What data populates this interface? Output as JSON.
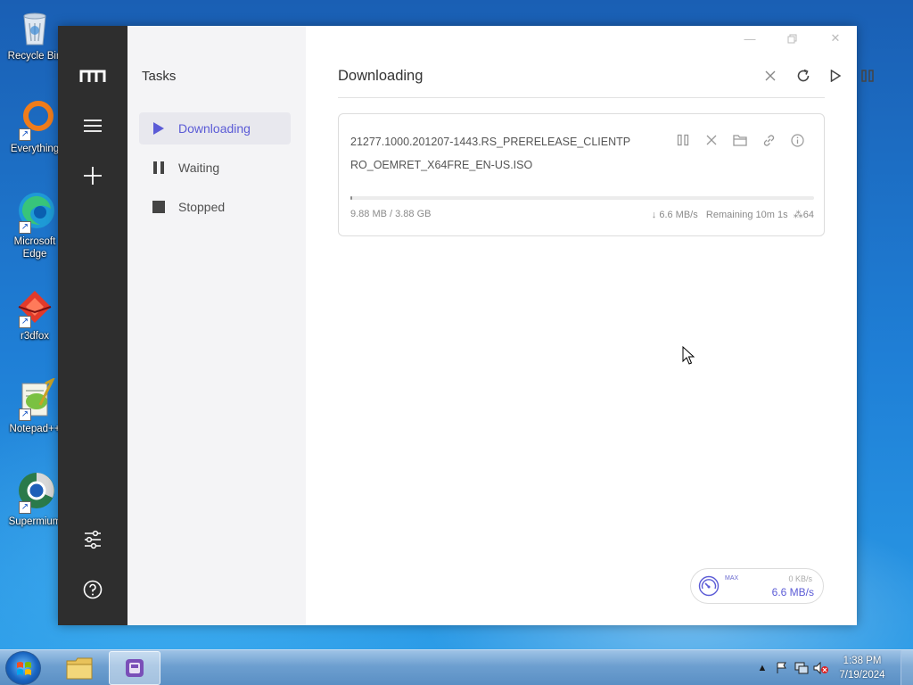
{
  "desktop": {
    "icons": [
      {
        "label": "Recycle Bin"
      },
      {
        "label": "Everything"
      },
      {
        "label": "Microsoft Edge"
      },
      {
        "label": "r3dfox"
      },
      {
        "label": "Notepad++"
      },
      {
        "label": "Supermium"
      }
    ]
  },
  "window": {
    "controls": {
      "minimize": "minimize",
      "maximize": "maximize",
      "close": "close"
    }
  },
  "sidebar": {
    "title": "Tasks",
    "items": [
      {
        "label": "Downloading",
        "icon": "play-icon",
        "active": true
      },
      {
        "label": "Waiting",
        "icon": "pause-icon",
        "active": false
      },
      {
        "label": "Stopped",
        "icon": "stop-icon",
        "active": false
      }
    ]
  },
  "rail": {
    "icons": [
      "logo-icon",
      "menu-icon",
      "add-icon",
      "settings-sliders-icon",
      "help-icon"
    ]
  },
  "main": {
    "title": "Downloading",
    "toolbar": [
      "clear-icon",
      "refresh-icon",
      "resume-all-icon",
      "pause-all-icon"
    ]
  },
  "task": {
    "name": "21277.1000.201207-1443.RS_PRERELEASE_CLIENTPRO_OEMRET_X64FRE_EN-US.ISO",
    "size_progress": "9.88 MB / 3.88 GB",
    "speed": "↓ 6.6 MB/s",
    "remaining": "Remaining 10m 1s",
    "connections": "64",
    "progress_fraction": 0.0025,
    "actions": [
      "pause-icon",
      "delete-icon",
      "folder-icon",
      "link-icon",
      "info-icon"
    ]
  },
  "speedometer": {
    "max_label": "MAX",
    "upload": "0 KB/s",
    "download": "6.6 MB/s"
  },
  "taskbar": {
    "time": "1:38 PM",
    "date": "7/19/2024"
  },
  "colors": {
    "accent": "#5b5bd6",
    "rail": "#2e2e2e",
    "sidebar": "#f4f4f6"
  }
}
